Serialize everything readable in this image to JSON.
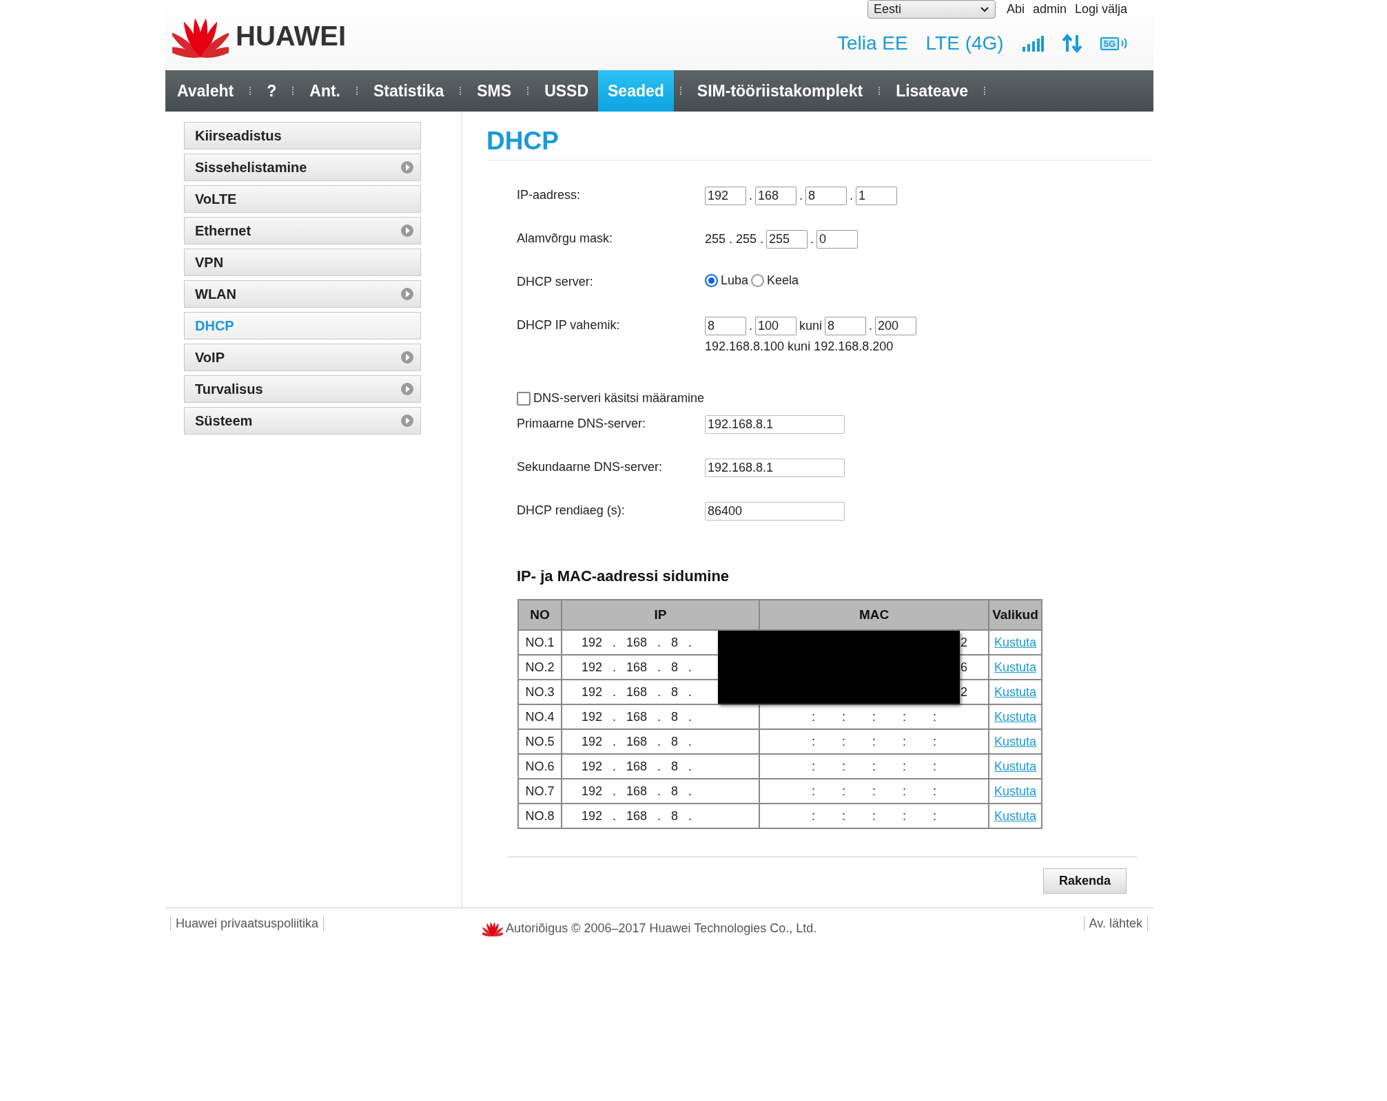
{
  "header": {
    "brand": "HUAWEI",
    "language": "Eesti",
    "links": [
      "Abi",
      "admin",
      "Logi välja"
    ],
    "operator": "Telia EE",
    "network": "LTE (4G)",
    "network_badge": "5G"
  },
  "nav": [
    {
      "label": "Avaleht",
      "selected": false
    },
    {
      "label": "?",
      "selected": false
    },
    {
      "label": "Ant.",
      "selected": false
    },
    {
      "label": "Statistika",
      "selected": false
    },
    {
      "label": "SMS",
      "selected": false
    },
    {
      "label": "USSD",
      "selected": false
    },
    {
      "label": "Seaded",
      "selected": true
    },
    {
      "label": "SIM-tööriistakomplekt",
      "selected": false
    },
    {
      "label": "Lisateave",
      "selected": false
    }
  ],
  "sidebar": {
    "items": [
      {
        "label": "Kiirseadistus",
        "selected": false,
        "expandable": false
      },
      {
        "label": "Sissehelistamine",
        "selected": false,
        "expandable": true
      },
      {
        "label": "VoLTE",
        "selected": false,
        "expandable": false
      },
      {
        "label": "Ethernet",
        "selected": false,
        "expandable": true
      },
      {
        "label": "VPN",
        "selected": false,
        "expandable": false
      },
      {
        "label": "WLAN",
        "selected": false,
        "expandable": true
      },
      {
        "label": "DHCP",
        "selected": true,
        "expandable": false
      },
      {
        "label": "VoIP",
        "selected": false,
        "expandable": true
      },
      {
        "label": "Turvalisus",
        "selected": false,
        "expandable": true
      },
      {
        "label": "Süsteem",
        "selected": false,
        "expandable": true
      }
    ]
  },
  "form": {
    "title": "DHCP",
    "rows": [
      {
        "kind": "parts",
        "label": "IP-aadress:",
        "parts": [
          {
            "kind": "input",
            "value": "192"
          },
          {
            "kind": "text",
            "value": "."
          },
          {
            "kind": "input",
            "value": "168"
          },
          {
            "kind": "text",
            "value": "."
          },
          {
            "kind": "input",
            "value": "8"
          },
          {
            "kind": "text",
            "value": "."
          },
          {
            "kind": "input",
            "value": "1"
          }
        ]
      },
      {
        "kind": "parts",
        "label": "Alamvõrgu mask:",
        "parts": [
          {
            "kind": "text",
            "value": "255 . 255 ."
          },
          {
            "kind": "input",
            "value": "255"
          },
          {
            "kind": "text",
            "value": "."
          },
          {
            "kind": "input",
            "value": "0"
          }
        ]
      },
      {
        "kind": "radio",
        "label": "DHCP server:",
        "options": [
          {
            "label": "Luba",
            "selected": true
          },
          {
            "label": "Keela",
            "selected": false
          }
        ]
      },
      {
        "kind": "parts",
        "label": "DHCP IP vahemik:",
        "parts": [
          {
            "kind": "input",
            "value": "8"
          },
          {
            "kind": "text",
            "value": "."
          },
          {
            "kind": "input",
            "value": "100"
          },
          {
            "kind": "text",
            "value": "kuni"
          },
          {
            "kind": "input",
            "value": "8"
          },
          {
            "kind": "text",
            "value": "."
          },
          {
            "kind": "input",
            "value": "200"
          }
        ],
        "note": "192.168.8.100 kuni 192.168.8.200"
      },
      {
        "kind": "checkbox",
        "label": "DNS-serveri käsitsi määramine",
        "checked": false
      },
      {
        "kind": "field",
        "label": "Primaarne DNS-server:",
        "value": "192.168.8.1"
      },
      {
        "kind": "field",
        "label": "Sekundaarne DNS-server:",
        "value": "192.168.8.1"
      },
      {
        "kind": "field",
        "label": "DHCP rendiaeg (s):",
        "value": "86400"
      }
    ]
  },
  "binding": {
    "title": "IP- ja MAC-aadressi sidumine",
    "columns": [
      "NO",
      "IP",
      "MAC",
      "Valikud"
    ],
    "rows": [
      {
        "no": "NO.1",
        "ip": "192 . 168 . 8 .",
        "mac": "2",
        "action": "Kustuta",
        "redacted": true
      },
      {
        "no": "NO.2",
        "ip": "192 . 168 . 8 .",
        "mac": "6",
        "action": "Kustuta",
        "redacted": true
      },
      {
        "no": "NO.3",
        "ip": "192 . 168 . 8 .",
        "mac": "2",
        "action": "Kustuta",
        "redacted": true
      },
      {
        "no": "NO.4",
        "ip": "192 . 168 . 8 .",
        "mac": ": : : : :",
        "action": "Kustuta",
        "redacted": false
      },
      {
        "no": "NO.5",
        "ip": "192 . 168 . 8 .",
        "mac": ": : : : :",
        "action": "Kustuta",
        "redacted": false
      },
      {
        "no": "NO.6",
        "ip": "192 . 168 . 8 .",
        "mac": ": : : : :",
        "action": "Kustuta",
        "redacted": false
      },
      {
        "no": "NO.7",
        "ip": "192 . 168 . 8 .",
        "mac": ": : : : :",
        "action": "Kustuta",
        "redacted": false
      },
      {
        "no": "NO.8",
        "ip": "192 . 168 . 8 .",
        "mac": ": : : : :",
        "action": "Kustuta",
        "redacted": false
      }
    ]
  },
  "apply_button": "Rakenda",
  "footer": {
    "privacy": "Huawei privaatsuspoliitika",
    "copyright": "Autoriõigus © 2006–2017 Huawei Technologies Co., Ltd.",
    "source": "Av. lähtek"
  }
}
